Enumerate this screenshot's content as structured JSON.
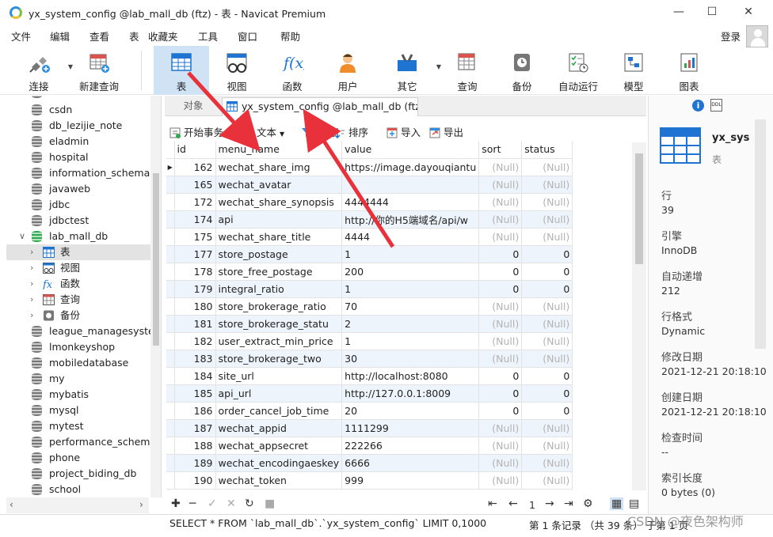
{
  "window": {
    "title": "yx_system_config @lab_mall_db (ftz) - 表 - Navicat Premium",
    "min_icon": "minimize-icon",
    "max_icon": "maximize-icon",
    "close_icon": "close-icon"
  },
  "menu": {
    "items": [
      "文件",
      "编辑",
      "查看",
      "表",
      "收藏夹",
      "工具",
      "窗口",
      "帮助"
    ],
    "login": "登录"
  },
  "toolbar": {
    "items": [
      {
        "label": "连接",
        "icon": "connection-icon"
      },
      {
        "label": "新建查询",
        "icon": "new-query-icon"
      },
      {
        "label": "表",
        "icon": "table-icon"
      },
      {
        "label": "视图",
        "icon": "view-icon"
      },
      {
        "label": "函数",
        "icon": "function-icon"
      },
      {
        "label": "用户",
        "icon": "user-icon"
      },
      {
        "label": "其它",
        "icon": "other-icon"
      },
      {
        "label": "查询",
        "icon": "query-icon"
      },
      {
        "label": "备份",
        "icon": "backup-icon"
      },
      {
        "label": "自动运行",
        "icon": "automation-icon"
      },
      {
        "label": "模型",
        "icon": "model-icon"
      },
      {
        "label": "图表",
        "icon": "chart-icon"
      }
    ]
  },
  "sidebar": {
    "databases_top": [
      "csdn",
      "db_lezijie_note",
      "eladmin",
      "hospital",
      "information_schema",
      "javaweb",
      "jdbc",
      "jdbctest"
    ],
    "open_db": "lab_mall_db",
    "children": [
      "表",
      "视图",
      "函数",
      "查询",
      "备份"
    ],
    "databases_bottom": [
      "league_managesystem",
      "lmonkeyshop",
      "mobiledatabase",
      "my",
      "mybatis",
      "mysql",
      "mytest",
      "performance_schema",
      "phone",
      "project_biding_db",
      "school"
    ]
  },
  "tabs": {
    "objects": "对象",
    "table_tab": "yx_system_config @lab_mall_db (ftz) ..."
  },
  "data_toolbar": {
    "begin_tx": "开始事务",
    "text": "文本",
    "filter": "筛选",
    "sort": "排序",
    "import": "导入",
    "export": "导出"
  },
  "grid": {
    "columns": [
      "id",
      "menu_name",
      "value",
      "sort",
      "status"
    ],
    "rows": [
      [
        "162",
        "wechat_share_img",
        "https://image.dayouqiantu",
        "(Null)",
        "(Null)"
      ],
      [
        "165",
        "wechat_avatar",
        "",
        "(Null)",
        "(Null)"
      ],
      [
        "172",
        "wechat_share_synopsis",
        "4444444",
        "(Null)",
        "(Null)"
      ],
      [
        "174",
        "api",
        "http://你的H5端域名/api/w",
        "(Null)",
        "(Null)"
      ],
      [
        "175",
        "wechat_share_title",
        "4444",
        "(Null)",
        "(Null)"
      ],
      [
        "177",
        "store_postage",
        "1",
        "0",
        "0"
      ],
      [
        "178",
        "store_free_postage",
        "200",
        "0",
        "0"
      ],
      [
        "179",
        "integral_ratio",
        "1",
        "0",
        "0"
      ],
      [
        "180",
        "store_brokerage_ratio",
        "70",
        "(Null)",
        "(Null)"
      ],
      [
        "181",
        "store_brokerage_statu",
        "2",
        "(Null)",
        "(Null)"
      ],
      [
        "182",
        "user_extract_min_price",
        "1",
        "(Null)",
        "(Null)"
      ],
      [
        "183",
        "store_brokerage_two",
        "30",
        "(Null)",
        "(Null)"
      ],
      [
        "184",
        "site_url",
        "http://localhost:8080",
        "0",
        "0"
      ],
      [
        "185",
        "api_url",
        "http://127.0.0.1:8009",
        "0",
        "0"
      ],
      [
        "186",
        "order_cancel_job_time",
        "20",
        "0",
        "0"
      ],
      [
        "187",
        "wechat_appid",
        "1111299",
        "(Null)",
        "(Null)"
      ],
      [
        "188",
        "wechat_appsecret",
        "222266",
        "(Null)",
        "(Null)"
      ],
      [
        "189",
        "wechat_encodingaeskey",
        "6666",
        "(Null)",
        "(Null)"
      ],
      [
        "190",
        "wechat_token",
        "999",
        "(Null)",
        "(Null)"
      ]
    ]
  },
  "nav": {
    "page": "1"
  },
  "status": {
    "sql": "SELECT * FROM `lab_mall_db`.`yx_system_config` LIMIT 0,1000",
    "records": "第 1 条记录 （共 39 条） 于第 1 页",
    "watermark": "CSDN @夜色架构师"
  },
  "info": {
    "name": "yx_sys",
    "kind": "表",
    "fields": [
      {
        "label": "行",
        "value": "39"
      },
      {
        "label": "引擎",
        "value": "InnoDB"
      },
      {
        "label": "自动递增",
        "value": "212"
      },
      {
        "label": "行格式",
        "value": "Dynamic"
      },
      {
        "label": "修改日期",
        "value": "2021-12-21 20:18:10"
      },
      {
        "label": "创建日期",
        "value": "2021-12-21 20:18:10"
      },
      {
        "label": "检查时间",
        "value": "--"
      },
      {
        "label": "索引长度",
        "value": "0 bytes (0)"
      }
    ]
  },
  "colors": {
    "accent": "#1e74d0",
    "selected_tool": "#cfe3f5",
    "alt_row": "#eef4fb",
    "arrow": "#e8313b"
  }
}
